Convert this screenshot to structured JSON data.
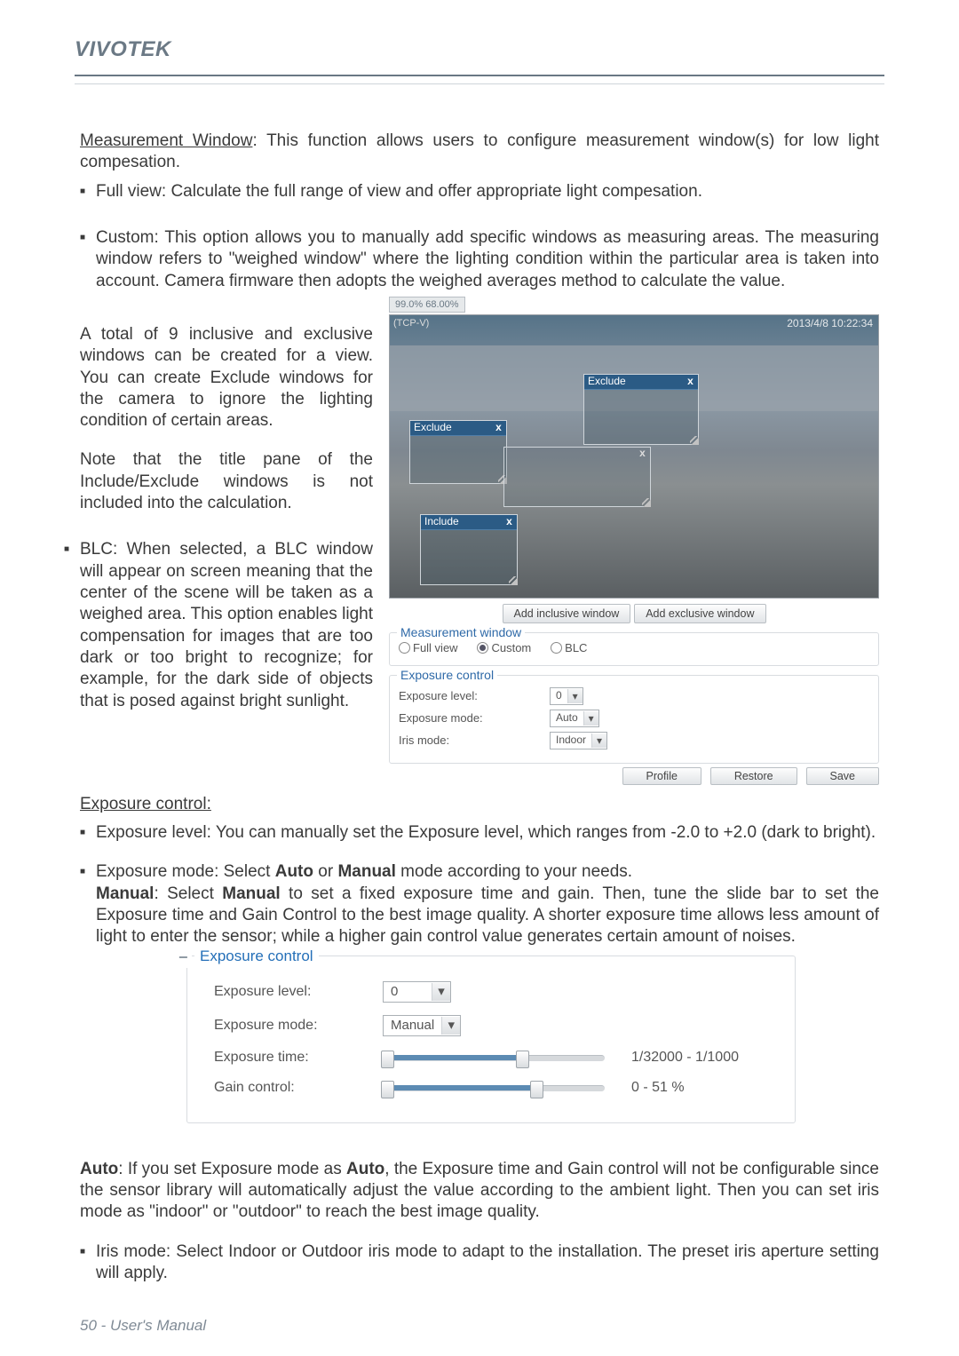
{
  "brand": "VIVOTEK",
  "footer": "50 - User's Manual",
  "intro": {
    "title": "Measurement Window",
    "text": ": This function allows users to configure measurement window(s) for low light compesation."
  },
  "bullets": {
    "full_view": "Full view: Calculate the full range of view and offer appropriate light compesation.",
    "custom": "Custom: This option allows you to manually add specific windows as measuring areas. The measuring window refers to \"weighed window\" where the lighting condition within the particular area is taken into account. Camera firmware then adopts the weighed averages method to calculate the value.",
    "custom_p1": "A total of 9 inclusive and exclusive windows can be created for a view. You can create Exclude windows for the camera to ignore the lighting condition of certain areas.",
    "custom_p2": "Note that the title pane of the Include/Exclude windows is not included into the calculation.",
    "blc": "BLC: When selected, a BLC window will appear on screen meaning that the center of the scene will be taken as a weighed area. This option enables light compensation for images that are too dark or too bright to recognize; for example, for the dark side of objects that is posed against bright sunlight."
  },
  "cfg": {
    "cache": "99.0% 68.00%",
    "tcp": "(TCP-V)",
    "timestamp": "2013/4/8 10:22:34",
    "boxes": {
      "exclude_a": "Exclude",
      "exclude_b": "Exclude",
      "include": "Include"
    },
    "add_inclusive": "Add inclusive window",
    "add_exclusive": "Add exclusive window",
    "measurement_legend": "Measurement window",
    "radios": {
      "full": "Full view",
      "custom": "Custom",
      "blc": "BLC"
    },
    "exposure_legend": "Exposure control",
    "rows": {
      "level_lbl": "Exposure level:",
      "level_val": "0",
      "mode_lbl": "Exposure mode:",
      "mode_val": "Auto",
      "iris_lbl": "Iris mode:",
      "iris_val": "Indoor"
    },
    "buttons": {
      "profile": "Profile",
      "restore": "Restore",
      "save": "Save"
    }
  },
  "exposure_title": "Exposure control:",
  "exposure_bullets": {
    "level": "Exposure level: You can manually set the Exposure level, which ranges from -2.0 to +2.0 (dark to bright).",
    "mode_head": "Exposure mode: Select ",
    "auto_word": "Auto",
    "or_word": " or ",
    "manual_word": "Manual",
    "mode_tail": " mode according to your needs.",
    "manual_lead": "Manual",
    "manual_body": ": Select ",
    "manual_body2": "Manual",
    "manual_body3": " to set a fixed exposure time and gain. Then, tune the slide bar to set the Exposure time and Gain Control to the best image quality. A shorter exposure time allows less amount of light to enter the sensor; while a higher gain control value generates certain amount of noises."
  },
  "panel2": {
    "legend": "Exposure control",
    "level_lbl": "Exposure level:",
    "level_val": "0",
    "mode_lbl": "Exposure mode:",
    "mode_val": "Manual",
    "time_lbl": "Exposure time:",
    "time_readout": "1/32000 - 1/1000",
    "gain_lbl": "Gain control:",
    "gain_readout": "0 - 51 %"
  },
  "after": {
    "auto_word": "Auto",
    "auto_text1": ": If you set Exposure mode as ",
    "auto_word2": "Auto",
    "auto_text2": ", the Exposure time and Gain control will not be configurable since the sensor library will automatically adjust the value according to the ambient light. Then you can set iris mode as \"indoor\" or \"outdoor\" to reach the best image quality.",
    "iris": "Iris mode: Select Indoor or Outdoor iris mode to adapt to the installation. The preset iris aperture setting will apply."
  }
}
